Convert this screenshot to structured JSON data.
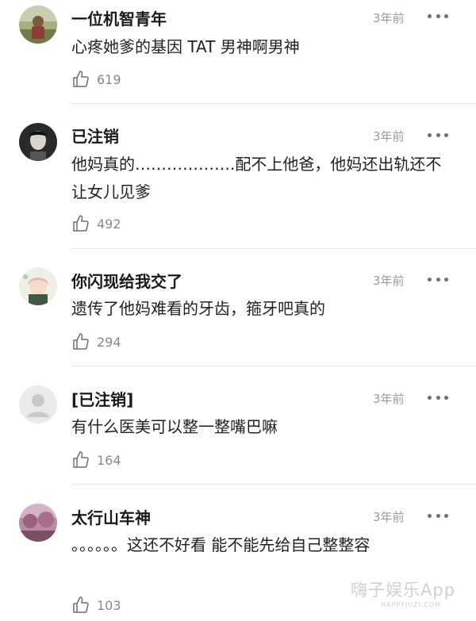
{
  "comments": [
    {
      "username": "一位机智青年",
      "time": "3年前",
      "content": "心疼她爹的基因 TAT 男神啊男神",
      "likes": "619",
      "avatar": "landscape-portrait-avatar"
    },
    {
      "username": "已注销",
      "time": "3年前",
      "content": "他妈真的……………….配不上他爸，他妈还出轨还不让女儿见爹",
      "likes": "492",
      "avatar": "woman-portrait-avatar"
    },
    {
      "username": "你闪现给我交了",
      "time": "3年前",
      "content": "遗传了他妈难看的牙齿，箍牙吧真的",
      "likes": "294",
      "avatar": "anime-girl-avatar"
    },
    {
      "username": "[已注销]",
      "time": "3年前",
      "content": "有什么医美可以整一整嘴巴嘛",
      "likes": "164",
      "avatar": "default-user-avatar"
    },
    {
      "username": "太行山车神",
      "time": "3年前",
      "content": "。。。。。。这还不好看 能不能先给自己整整容",
      "likes": "103",
      "avatar": "pink-trees-avatar"
    }
  ],
  "watermark": {
    "text": "嗨子娱乐App",
    "url": "HAPPYJUZI.COM"
  },
  "colors": {
    "text": "#222222",
    "meta": "#9b9b9b",
    "divider": "#e6e6e6"
  }
}
